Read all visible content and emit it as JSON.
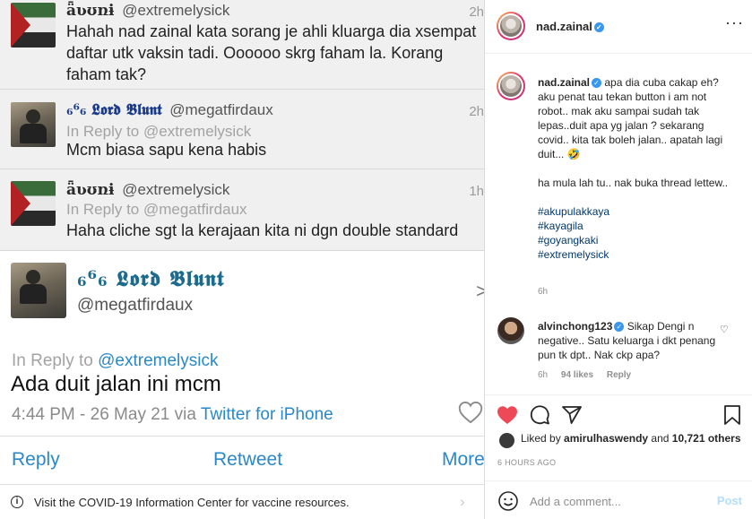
{
  "twitter": {
    "tweets": [
      {
        "display_name": "ǟʋʊռɨ",
        "handle": "@extremelysick",
        "time": "2h",
        "text": "Hahah nad zainal kata sorang je ahli kluarga dia xsempat daftar utk vaksin tadi. Oooooo skrg faham la. Korang faham tak?"
      },
      {
        "display_name": "₆⁶₆ 𝕷𝖔𝖗𝖉 𝕭𝖑𝖚𝖓𝖙",
        "handle": "@megatfirdaux",
        "time": "2h",
        "reply_to": "In Reply to @extremelysick",
        "text": "Mcm biasa sapu kena habis"
      },
      {
        "display_name": "ǟʋʊռɨ",
        "handle": "@extremelysick",
        "time": "1h",
        "reply_to": "In Reply to @megatfirdaux",
        "text": "Haha cliche sgt la kerajaan kita ni dgn double standard"
      }
    ],
    "main_tweet": {
      "display_name": "₆⁶₆ 𝕷𝖔𝖗𝖉 𝕭𝖑𝖚𝖓𝖙",
      "handle": "@megatfirdaux",
      "reply_prefix": "In Reply to",
      "reply_handle": "@extremelysick",
      "text": "Ada duit jalan ini mcm",
      "timestamp": "4:44 PM - 26 May 21 via",
      "via_app": "Twitter for iPhone",
      "actions": {
        "reply": "Reply",
        "retweet": "Retweet",
        "more": "More"
      }
    },
    "covid_banner": "Visit the COVID-19 Information Center for vaccine resources."
  },
  "instagram": {
    "header": {
      "username": "nad.zainal",
      "more_label": "···"
    },
    "caption": {
      "username": "nad.zainal",
      "paragraph1": "apa dia cuba cakap eh? aku penat tau tekan button i am not robot.. mak aku sampai sudah tak lepas..duit apa yg jalan ? sekarang covid.. kita tak boleh jalan.. apatah lagi duit... 🤣",
      "paragraph2": "ha mula lah tu.. nak buka thread lettew..",
      "hashtags": [
        "#akupulakkaya",
        "#kayagila",
        "#goyangkaki",
        "#extremelysick"
      ],
      "time": "6h"
    },
    "comment": {
      "username": "alvinchong123",
      "text": "Sikap Dengi n negative.. Satu keluarga i dkt penang pun tk dpt.. Nak ckp apa?",
      "time": "6h",
      "likes": "94 likes",
      "reply": "Reply"
    },
    "likes": {
      "prefix": "Liked by",
      "user": "amirulhaswendy",
      "and": "and",
      "others": "10,721 others"
    },
    "ago": "6 HOURS AGO",
    "add_comment_placeholder": "Add a comment...",
    "post_label": "Post",
    "colors": {
      "heart": "#ed4956",
      "link": "#00376b",
      "post": "#b2dffc",
      "tw_link": "#2a88c8"
    }
  }
}
